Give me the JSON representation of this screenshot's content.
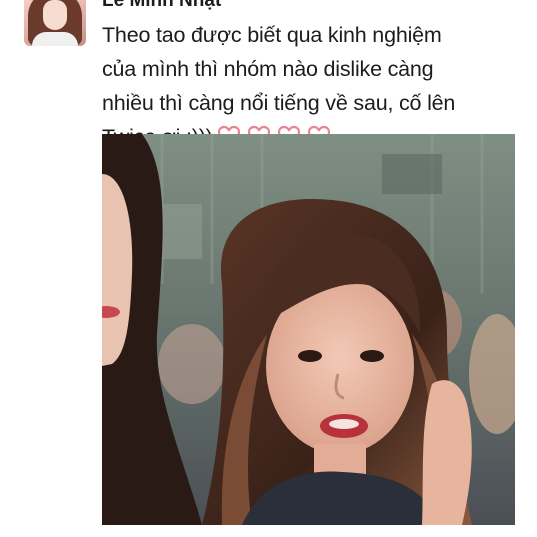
{
  "post": {
    "author": "Lê Minh Nhật",
    "text_lines": [
      "Theo tao được biết qua kinh nghiệm",
      "của mình thì nhóm nào dislike càng",
      "nhiều thì càng nổi tiếng về sau, cố lên",
      "Twice ơi :)))"
    ],
    "reaction_icons": [
      "heart-outline-icon",
      "heart-outline-icon",
      "heart-outline-icon",
      "heart-outline-icon"
    ],
    "heart_color": "#e8858e"
  },
  "colors": {
    "background": "#ffffff",
    "text": "#1c1c1c"
  }
}
